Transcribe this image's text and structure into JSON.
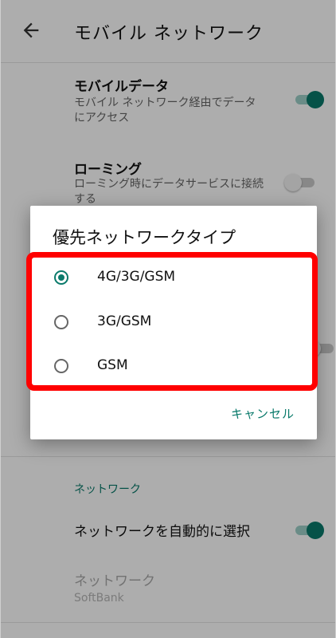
{
  "appbar": {
    "title": "モバイル ネットワーク"
  },
  "settings": {
    "mobile_data": {
      "title": "モバイルデータ",
      "subtitle": "モバイル ネットワーク経由でデータにアクセス",
      "enabled": true
    },
    "roaming": {
      "title": "ローミング",
      "subtitle": "ローミング時にデータサービスに接続する",
      "enabled": false
    },
    "section_network": {
      "header": "ネットワーク"
    },
    "auto_select": {
      "title": "ネットワークを自動的に選択",
      "enabled": true
    },
    "network": {
      "title": "ネットワーク",
      "value": "SoftBank"
    }
  },
  "dialog": {
    "title": "優先ネットワークタイプ",
    "options": [
      {
        "label": "4G/3G/GSM",
        "selected": true
      },
      {
        "label": "3G/GSM",
        "selected": false
      },
      {
        "label": "GSM",
        "selected": false
      }
    ],
    "cancel_label": "キャンセル"
  },
  "colors": {
    "accent": "#0a7a6b",
    "highlight": "#ff0000"
  },
  "icons": {
    "back": "arrow-left-icon"
  }
}
